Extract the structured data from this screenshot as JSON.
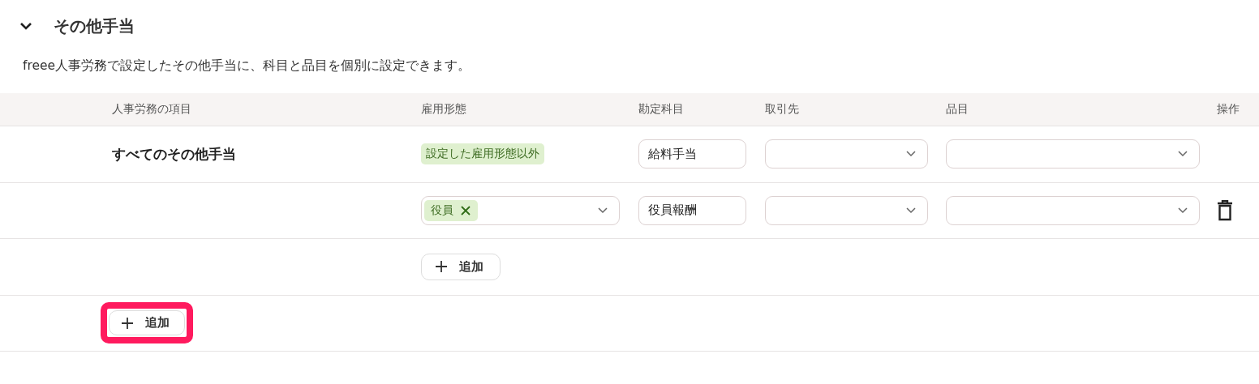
{
  "section": {
    "title": "その他手当",
    "expanded": true,
    "description": "freee人事労務で設定したその他手当に、科目と品目を個別に設定できます。"
  },
  "table": {
    "columns": [
      "人事労務の項目",
      "雇用形態",
      "勘定科目",
      "取引先",
      "品目",
      "操作"
    ],
    "rows": [
      {
        "name": "すべてのその他手当",
        "employment": {
          "kind": "tag",
          "tags": [
            {
              "label": "設定した雇用形態以外",
              "removable": false
            }
          ]
        },
        "account": "給料手当",
        "deletable": false
      },
      {
        "employment": {
          "kind": "select",
          "tags": [
            {
              "label": "役員",
              "removable": true
            }
          ]
        },
        "account": "役員報酬",
        "deletable": true
      }
    ],
    "add_row_button": {
      "label": "追加"
    },
    "add_group_button": {
      "label": "追加",
      "highlighted": true
    }
  }
}
